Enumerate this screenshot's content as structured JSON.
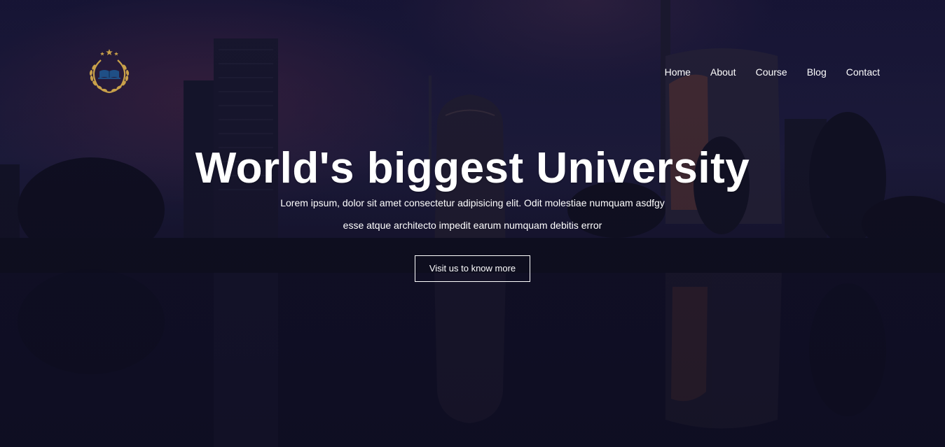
{
  "colors": {
    "sky_top": "#1b1a3c",
    "sky_mid": "#2a2750",
    "glow": "#7a3a5a",
    "ground": "#0d0d1c",
    "logo_gold": "#c9a14a",
    "text": "#ffffff"
  },
  "header": {
    "logo_icon": "laurel-wreath-book-icon",
    "nav": [
      {
        "label": "Home"
      },
      {
        "label": "About"
      },
      {
        "label": "Course"
      },
      {
        "label": "Blog"
      },
      {
        "label": "Contact"
      }
    ]
  },
  "hero": {
    "title": "World's biggest University",
    "subtitle_line1": "Lorem ipsum, dolor sit amet consectetur adipisicing elit. Odit molestiae numquam asdfgy",
    "subtitle_line2": "esse atque architecto impedit earum numquam debitis error",
    "cta_label": "Visit us to know more"
  }
}
